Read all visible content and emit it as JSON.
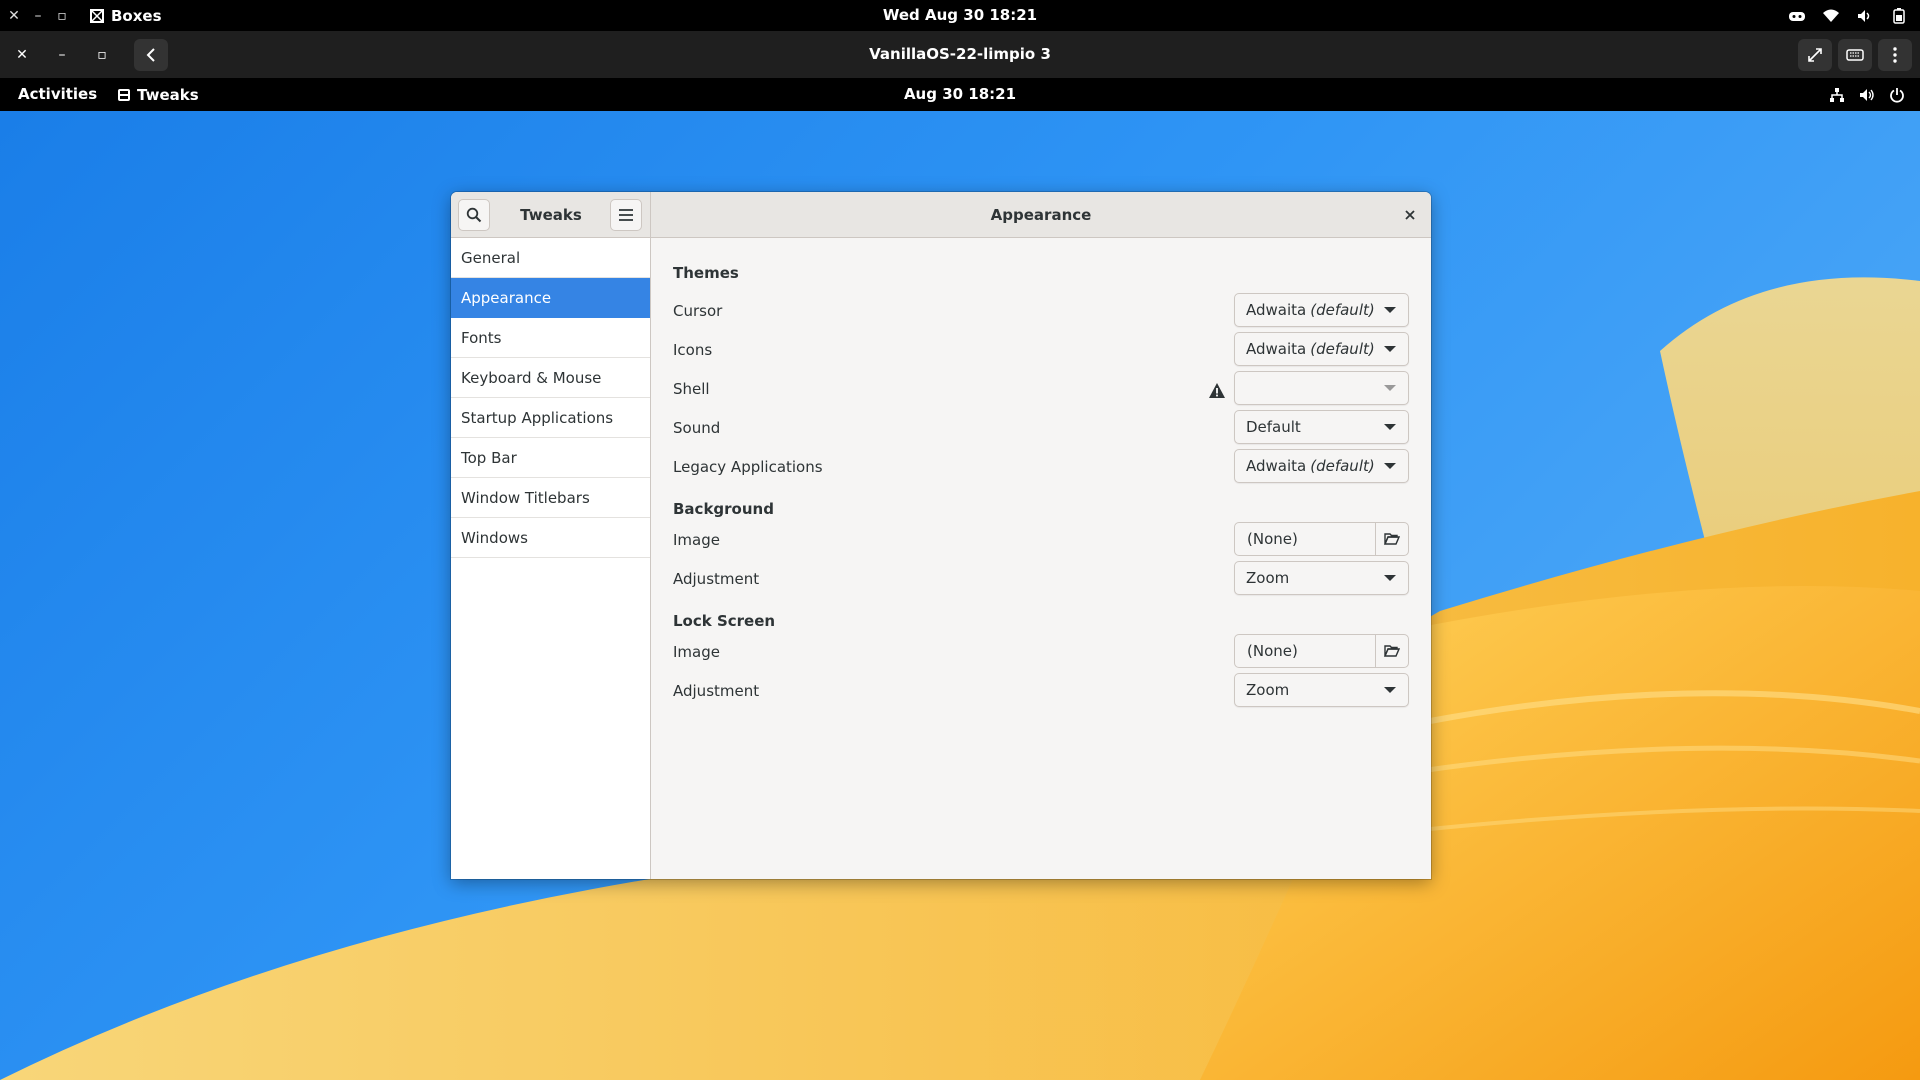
{
  "host_bar": {
    "app_name": "Boxes",
    "clock": "Wed Aug 30  18:21",
    "icons": [
      "close-icon",
      "minimize-icon",
      "maximize-icon",
      "boxes-app-icon",
      "game-controller-icon",
      "wifi-icon",
      "volume-icon",
      "battery-icon"
    ]
  },
  "boxes_bar": {
    "title": "VanillaOS-22-limpio 3",
    "icons": [
      "close-icon",
      "minimize-icon",
      "maximize-icon",
      "back-icon",
      "fullscreen-icon",
      "keyboard-icon",
      "menu-icon"
    ]
  },
  "guest_bar": {
    "activities": "Activities",
    "app_name": "Tweaks",
    "clock": "Aug 30  18:21",
    "icons": [
      "network-icon",
      "volume-icon",
      "power-icon"
    ]
  },
  "tweaks": {
    "sidebar_title": "Tweaks",
    "page_title": "Appearance",
    "sidebar_items": [
      "General",
      "Appearance",
      "Fonts",
      "Keyboard & Mouse",
      "Startup Applications",
      "Top Bar",
      "Window Titlebars",
      "Windows"
    ],
    "active_item": "Appearance",
    "sections": {
      "themes": {
        "title": "Themes",
        "cursor": {
          "label": "Cursor",
          "value": "Adwaita",
          "suffix": "(default)"
        },
        "icons": {
          "label": "Icons",
          "value": "Adwaita",
          "suffix": "(default)"
        },
        "shell": {
          "label": "Shell",
          "value": ""
        },
        "sound": {
          "label": "Sound",
          "value": "Default"
        },
        "legacy": {
          "label": "Legacy Applications",
          "value": "Adwaita",
          "suffix": "(default)"
        }
      },
      "background": {
        "title": "Background",
        "image": {
          "label": "Image",
          "value": "(None)"
        },
        "adjustment": {
          "label": "Adjustment",
          "value": "Zoom"
        }
      },
      "lock_screen": {
        "title": "Lock Screen",
        "image": {
          "label": "Image",
          "value": "(None)"
        },
        "adjustment": {
          "label": "Adjustment",
          "value": "Zoom"
        }
      }
    }
  },
  "colors": {
    "accent": "#3584e4",
    "desktop_blue": "#2f95f5",
    "wallpaper_orange": "#f7a81b"
  }
}
